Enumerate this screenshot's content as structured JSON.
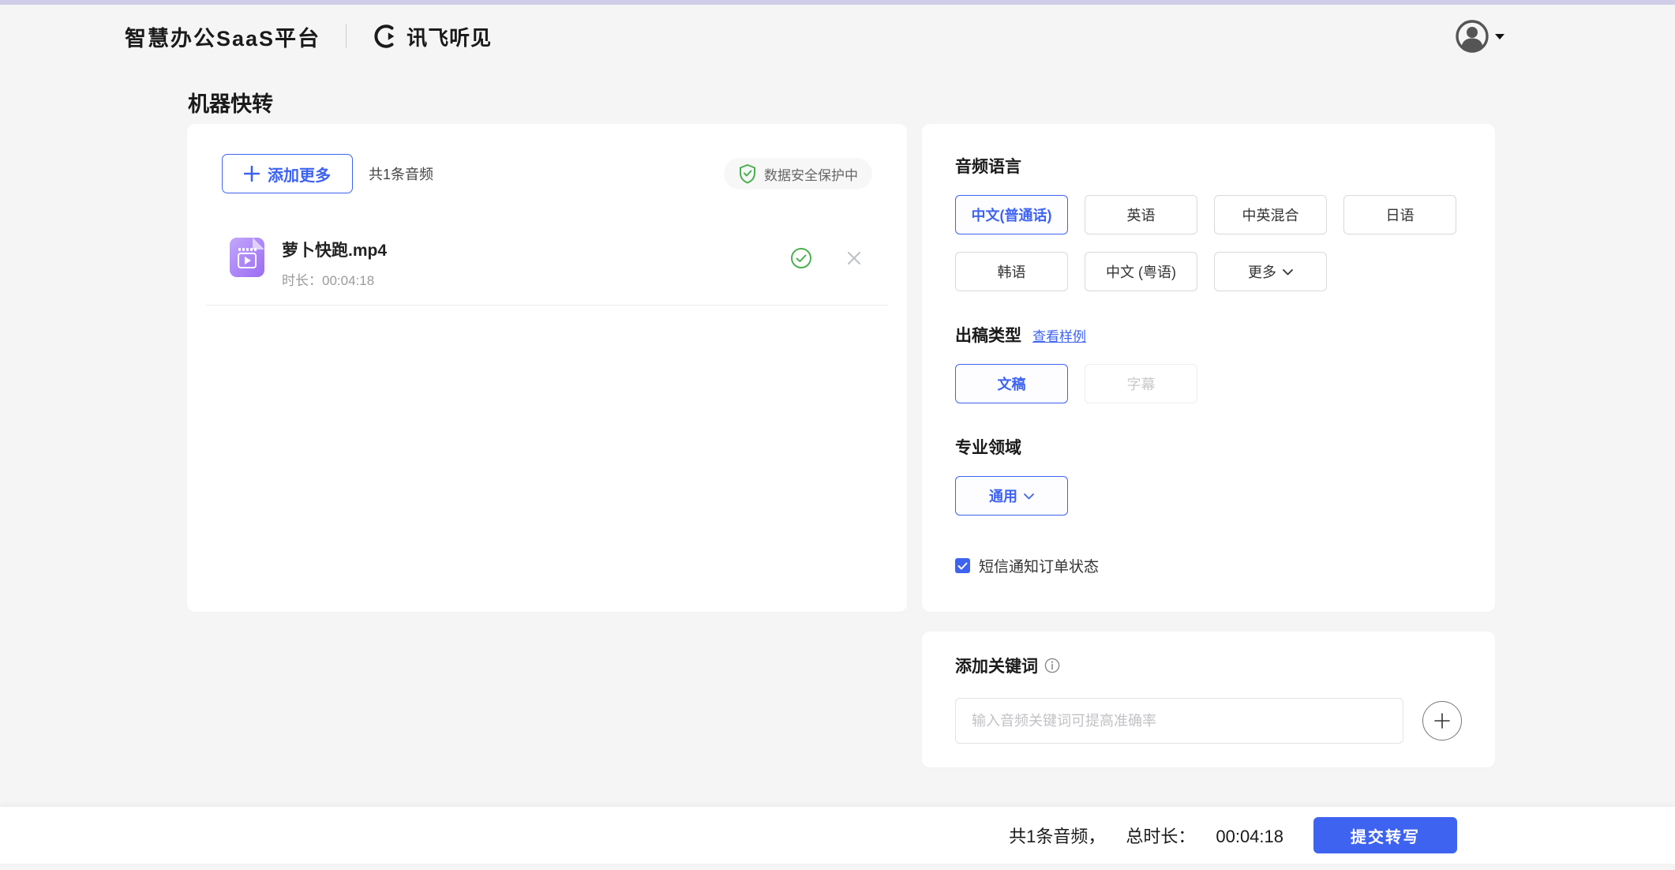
{
  "header": {
    "platform_title": "智慧办公SaaS平台",
    "product_name": "讯飞听见"
  },
  "page": {
    "title": "机器快转"
  },
  "upload": {
    "add_more_label": "添加更多",
    "count_label": "共1条音频",
    "security_label": "数据安全保护中",
    "file": {
      "name": "萝卜快跑.mp4",
      "duration_label": "时长：00:04:18",
      "status": "success"
    }
  },
  "options": {
    "language": {
      "title": "音频语言",
      "items": [
        {
          "label": "中文(普通话)",
          "selected": true
        },
        {
          "label": "英语",
          "selected": false
        },
        {
          "label": "中英混合",
          "selected": false
        },
        {
          "label": "日语",
          "selected": false
        },
        {
          "label": "韩语",
          "selected": false
        },
        {
          "label": "中文 (粤语)",
          "selected": false
        },
        {
          "label": "更多",
          "selected": false,
          "dropdown": true
        }
      ]
    },
    "output_type": {
      "title": "出稿类型",
      "sample_link": "查看样例",
      "items": [
        {
          "label": "文稿",
          "selected": true
        },
        {
          "label": "字幕",
          "disabled": true
        }
      ]
    },
    "domain": {
      "title": "专业领域",
      "selected_value": "通用"
    },
    "sms": {
      "label": "短信通知订单状态",
      "checked": true
    }
  },
  "keywords": {
    "title": "添加关键词",
    "placeholder": "输入音频关键词可提高准确率"
  },
  "footer": {
    "count_text": "共1条音频，",
    "duration_label": "总时长：",
    "duration_value": "00:04:18",
    "submit_label": "提交转写"
  },
  "colors": {
    "accent_blue": "#3e63f0",
    "success_green": "#4caf50",
    "file_icon_purple": "#9b6bf3",
    "top_strip_lavender": "#cfcde7",
    "page_background": "#f5f5f6"
  }
}
